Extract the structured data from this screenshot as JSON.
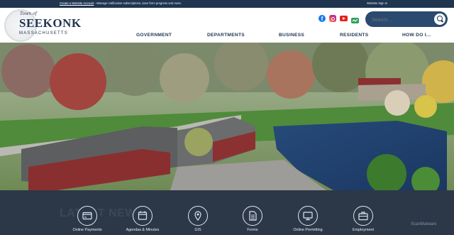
{
  "top_bar": {
    "message_link": "Create a Website Account",
    "message_rest": " - Manage notification subscriptions, save form progress and more.",
    "sign_in": "Website Sign In"
  },
  "logo": {
    "town_of": "Town of",
    "name": "SEEKONK",
    "state": "MASSACHUSETTS"
  },
  "social_icons": [
    "facebook-icon",
    "instagram-icon",
    "youtube-icon",
    "twitter-icon"
  ],
  "search": {
    "placeholder": "Search..."
  },
  "nav": [
    {
      "label": "GOVERNMENT"
    },
    {
      "label": "DEPARTMENTS"
    },
    {
      "label": "BUSINESS"
    },
    {
      "label": "RESIDENTS"
    },
    {
      "label": "HOW DO I..."
    }
  ],
  "news": {
    "heading": "LATEST NEWS"
  },
  "quick_links": [
    {
      "label": "Online Payments",
      "icon": "payment-card-icon"
    },
    {
      "label": "Agendas & Minutes",
      "icon": "calendar-icon"
    },
    {
      "label": "GIS",
      "icon": "map-pin-icon"
    },
    {
      "label": "Forms",
      "icon": "document-icon"
    },
    {
      "label": "Online Permitting",
      "icon": "monitor-icon"
    },
    {
      "label": "Employment",
      "icon": "briefcase-icon"
    }
  ],
  "colors": {
    "top_bar": "#1f3550",
    "brand_navy": "#1f3550",
    "search_bg": "#2b4a70",
    "footer_bg": "#2c3848"
  },
  "watermark": "ScanMalware"
}
